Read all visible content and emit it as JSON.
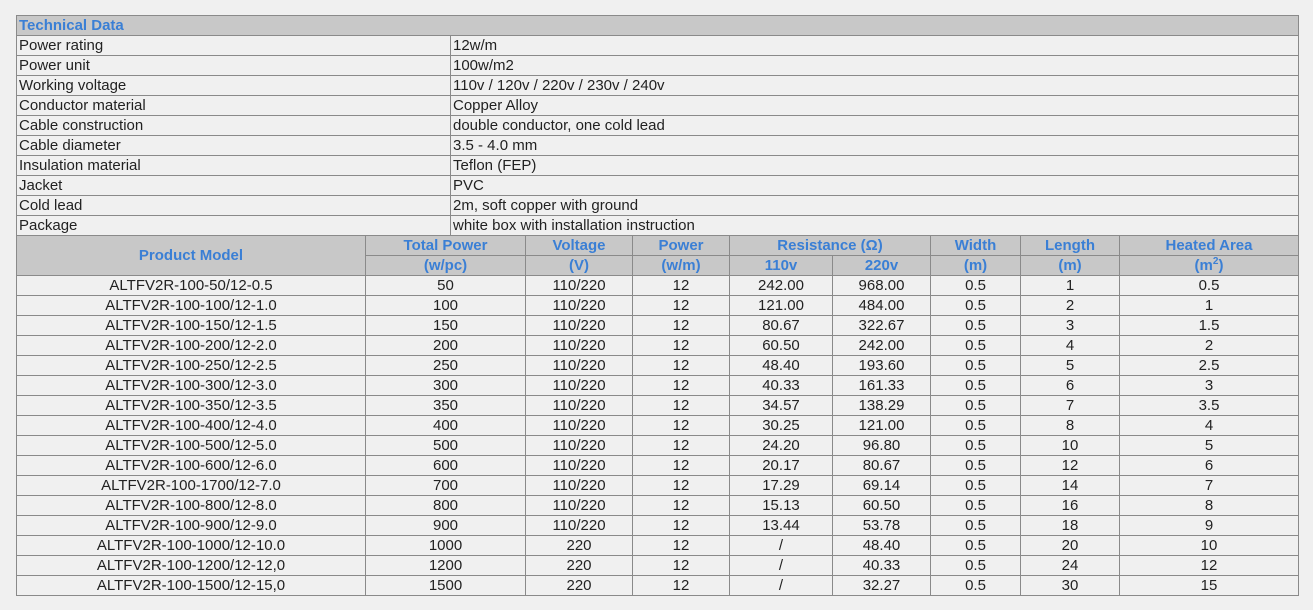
{
  "tech": {
    "title": "Technical Data",
    "rows": [
      [
        "Power rating",
        "12w/m"
      ],
      [
        "Power unit",
        "100w/m2"
      ],
      [
        "Working voltage",
        "110v / 120v / 220v / 230v / 240v"
      ],
      [
        "Conductor material",
        "Copper Alloy"
      ],
      [
        "Cable construction",
        "double conductor, one cold lead"
      ],
      [
        "Cable diameter",
        "3.5 - 4.0 mm"
      ],
      [
        "Insulation material",
        "Teflon (FEP)"
      ],
      [
        "Jacket",
        "PVC"
      ],
      [
        "Cold lead",
        "2m, soft copper with ground"
      ],
      [
        "Package",
        "white box with installation instruction"
      ]
    ]
  },
  "product": {
    "headers": {
      "model": "Product Model",
      "total_power": "Total Power",
      "total_power_unit": "(w/pc)",
      "voltage": "Voltage",
      "voltage_unit": "(V)",
      "power": "Power",
      "power_unit": "(w/m)",
      "resistance": "Resistance (Ω)",
      "r110": "110v",
      "r220": "220v",
      "width": "Width",
      "width_unit": "(m)",
      "length": "Length",
      "length_unit": "(m)",
      "area": "Heated Area",
      "area_unit_pre": "(m",
      "area_unit_sup": "2",
      "area_unit_post": ")"
    },
    "rows": [
      [
        "ALTFV2R-100-50/12-0.5",
        "50",
        "110/220",
        "12",
        "242.00",
        "968.00",
        "0.5",
        "1",
        "0.5"
      ],
      [
        "ALTFV2R-100-100/12-1.0",
        "100",
        "110/220",
        "12",
        "121.00",
        "484.00",
        "0.5",
        "2",
        "1"
      ],
      [
        "ALTFV2R-100-150/12-1.5",
        "150",
        "110/220",
        "12",
        "80.67",
        "322.67",
        "0.5",
        "3",
        "1.5"
      ],
      [
        "ALTFV2R-100-200/12-2.0",
        "200",
        "110/220",
        "12",
        "60.50",
        "242.00",
        "0.5",
        "4",
        "2"
      ],
      [
        "ALTFV2R-100-250/12-2.5",
        "250",
        "110/220",
        "12",
        "48.40",
        "193.60",
        "0.5",
        "5",
        "2.5"
      ],
      [
        "ALTFV2R-100-300/12-3.0",
        "300",
        "110/220",
        "12",
        "40.33",
        "161.33",
        "0.5",
        "6",
        "3"
      ],
      [
        "ALTFV2R-100-350/12-3.5",
        "350",
        "110/220",
        "12",
        "34.57",
        "138.29",
        "0.5",
        "7",
        "3.5"
      ],
      [
        "ALTFV2R-100-400/12-4.0",
        "400",
        "110/220",
        "12",
        "30.25",
        "121.00",
        "0.5",
        "8",
        "4"
      ],
      [
        "ALTFV2R-100-500/12-5.0",
        "500",
        "110/220",
        "12",
        "24.20",
        "96.80",
        "0.5",
        "10",
        "5"
      ],
      [
        "ALTFV2R-100-600/12-6.0",
        "600",
        "110/220",
        "12",
        "20.17",
        "80.67",
        "0.5",
        "12",
        "6"
      ],
      [
        "ALTFV2R-100-1700/12-7.0",
        "700",
        "110/220",
        "12",
        "17.29",
        "69.14",
        "0.5",
        "14",
        "7"
      ],
      [
        "ALTFV2R-100-800/12-8.0",
        "800",
        "110/220",
        "12",
        "15.13",
        "60.50",
        "0.5",
        "16",
        "8"
      ],
      [
        "ALTFV2R-100-900/12-9.0",
        "900",
        "110/220",
        "12",
        "13.44",
        "53.78",
        "0.5",
        "18",
        "9"
      ],
      [
        "ALTFV2R-100-1000/12-10.0",
        "1000",
        "220",
        "12",
        "/",
        "48.40",
        "0.5",
        "20",
        "10"
      ],
      [
        "ALTFV2R-100-1200/12-12,0",
        "1200",
        "220",
        "12",
        "/",
        "40.33",
        "0.5",
        "24",
        "12"
      ],
      [
        "ALTFV2R-100-1500/12-15,0",
        "1500",
        "220",
        "12",
        "/",
        "32.27",
        "0.5",
        "30",
        "15"
      ]
    ]
  }
}
